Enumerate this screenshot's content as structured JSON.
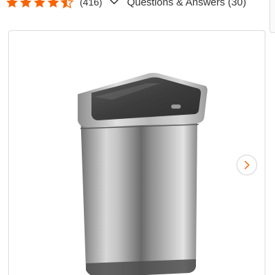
{
  "rating": {
    "value": 4.5,
    "max": 5,
    "review_count": "(416)",
    "star_color": "#f96302"
  },
  "questions_link": "Questions & Answers (30)",
  "product_image": {
    "alt": "Stainless steel motion sensor trash can",
    "icon": "trash-can-image"
  },
  "carousel": {
    "next_icon": "chevron-right-icon",
    "accent_color": "#f96302"
  }
}
